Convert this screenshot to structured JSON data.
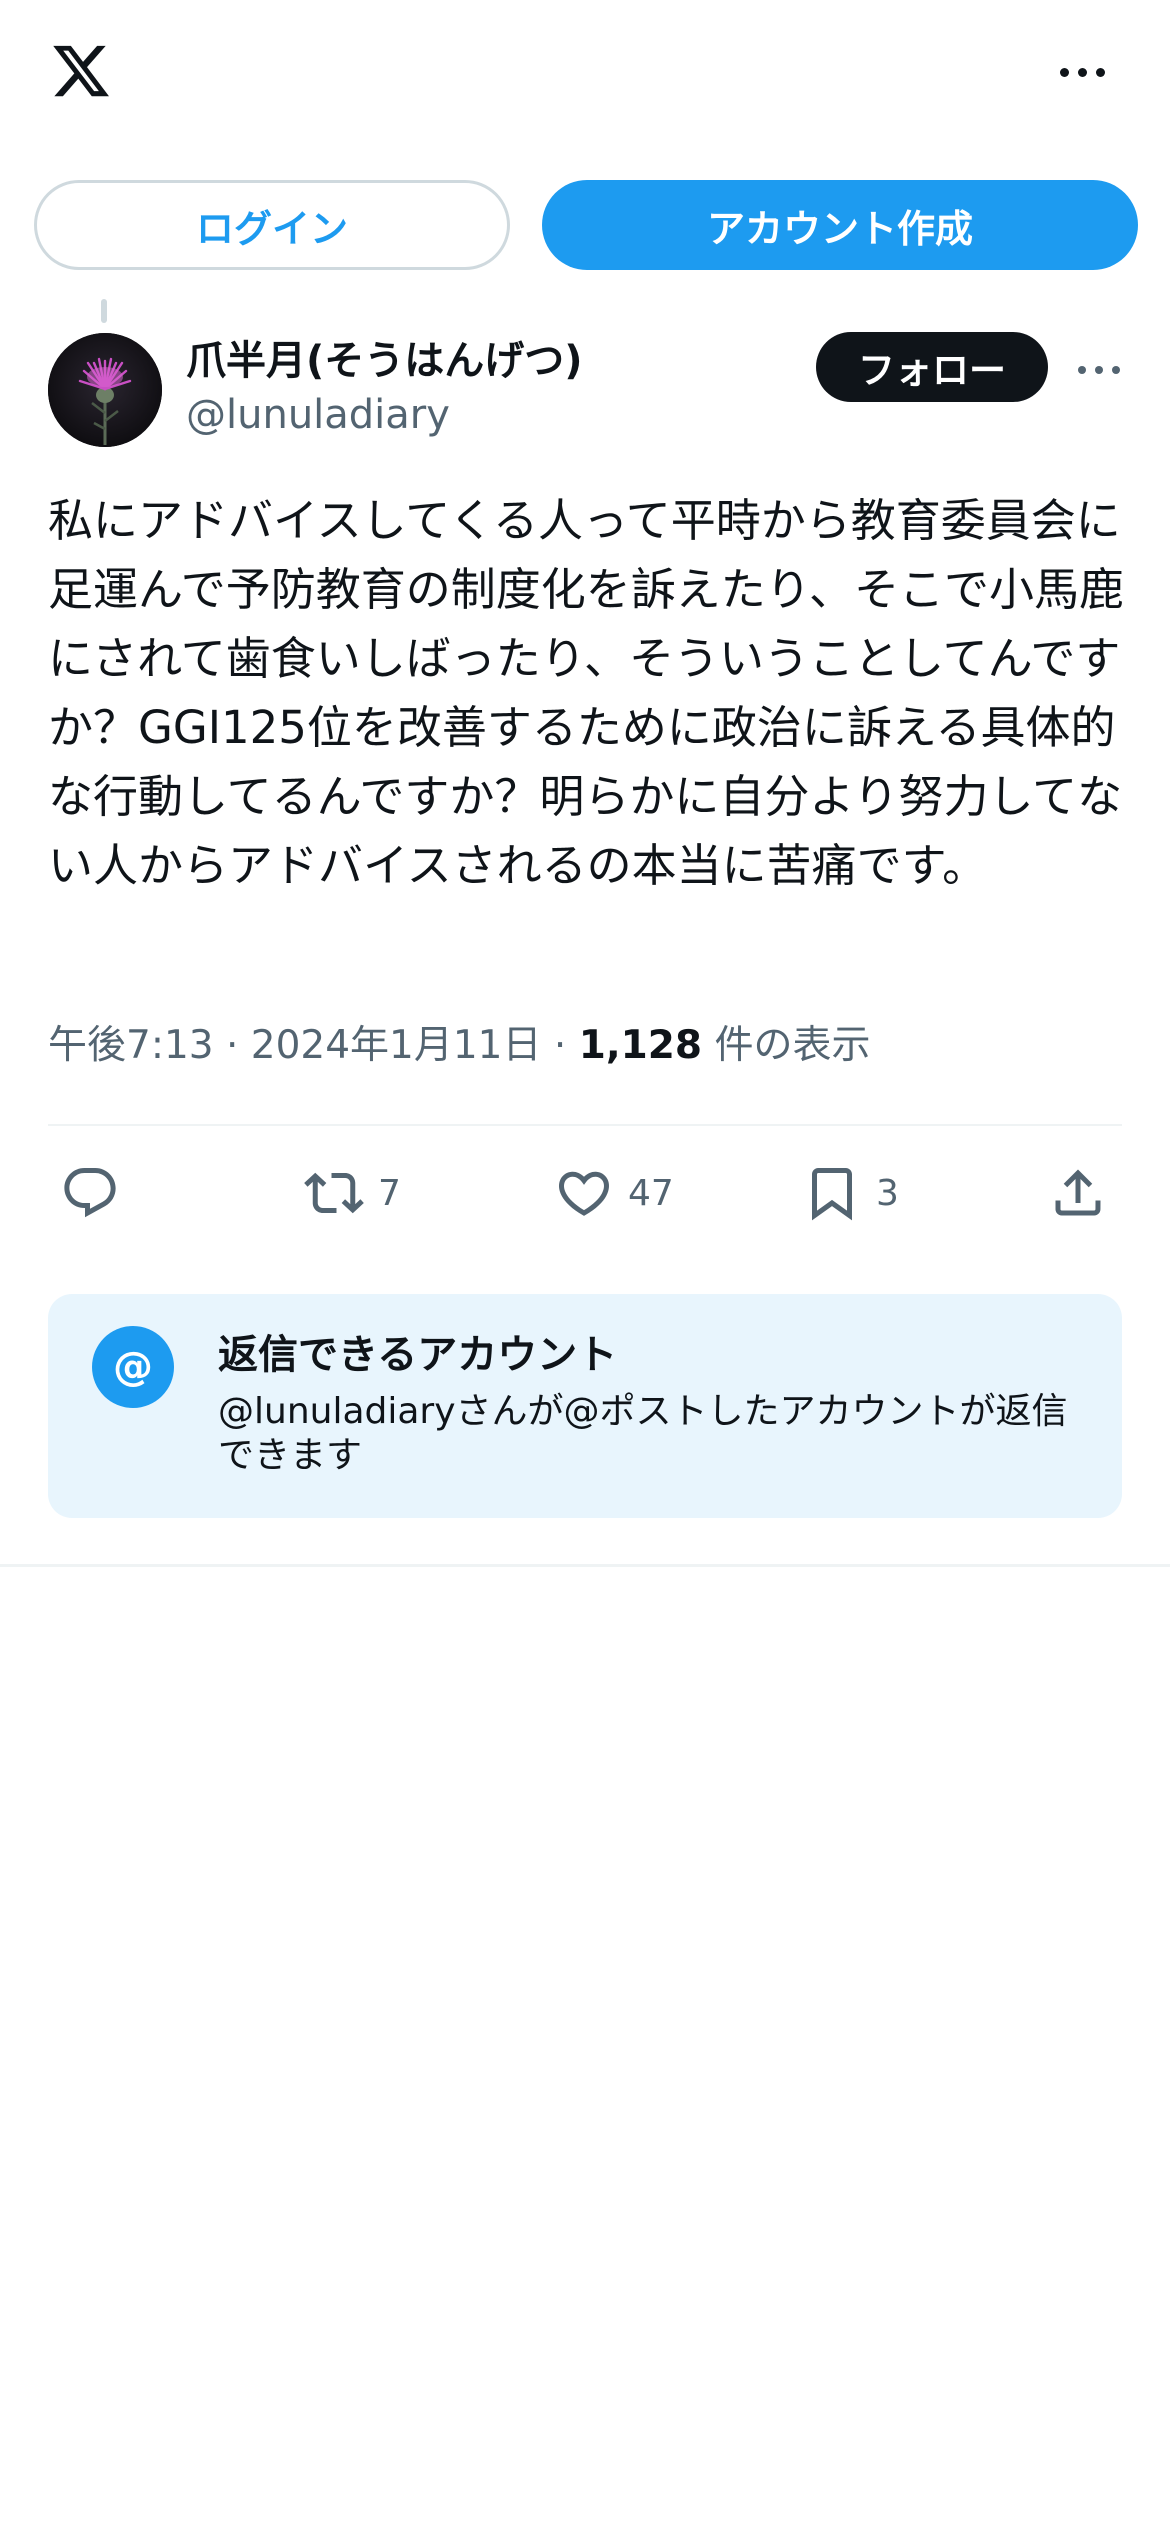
{
  "header": {
    "logo_icon": "x-logo-icon",
    "more_icon": "more-horizontal-icon"
  },
  "auth": {
    "login_label": "ログイン",
    "signup_label": "アカウント作成"
  },
  "tweet": {
    "author": {
      "display_name": "爪半月(そうはんげつ)",
      "handle": "@lunuladiary"
    },
    "follow_label": "フォロー",
    "text": "私にアドバイスしてくる人って平時から教育委員会に足運んで予防教育の制度化を訴えたり、そこで小馬鹿にされて歯食いしばったり、そういうことしてんですか？GGI125位を改善するために政治に訴える具体的な行動してるんですか？明らかに自分より努力してない人からアドバイスされるの本当に苦痛です。",
    "time": "午後7:13",
    "separator": " · ",
    "date": "2024年1月11日",
    "views_count": "1,128",
    "views_label": " 件の表示",
    "actions": {
      "reply_icon": "reply-icon",
      "retweet_count": "7",
      "like_count": "47",
      "bookmark_count": "3",
      "share_icon": "share-icon"
    }
  },
  "reply_restriction": {
    "icon": "@",
    "title": "返信できるアカウント",
    "description": "@lunuladiaryさんが@ポストしたアカウントが返信できます"
  },
  "colors": {
    "accent": "#1d9bf0",
    "text": "#0f1419",
    "secondary_text": "#536471",
    "border": "#cfd9de",
    "reply_box_bg": "#e8f5fd"
  }
}
